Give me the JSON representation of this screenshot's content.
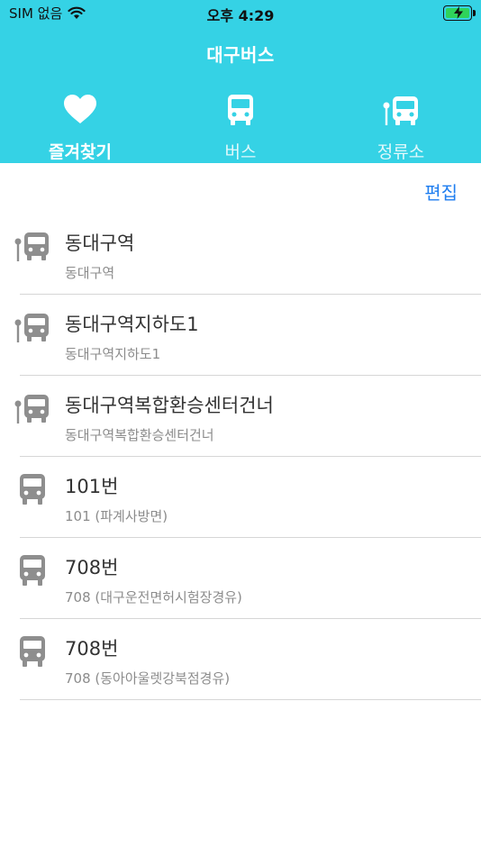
{
  "status_bar": {
    "carrier": "SIM 없음",
    "time": "오후 4:29",
    "battery_icon": "charging-battery-icon"
  },
  "header": {
    "title": "대구버스"
  },
  "tabs": [
    {
      "label": "즐겨찾기",
      "icon": "heart-icon",
      "active": true
    },
    {
      "label": "버스",
      "icon": "bus-icon",
      "active": false
    },
    {
      "label": "정류소",
      "icon": "bus-stop-icon",
      "active": false
    }
  ],
  "toolbar": {
    "edit_label": "편집"
  },
  "favorites": [
    {
      "type": "stop",
      "icon": "bus-stop-icon",
      "title": "동대구역",
      "subtitle": "동대구역"
    },
    {
      "type": "stop",
      "icon": "bus-stop-icon",
      "title": "동대구역지하도1",
      "subtitle": "동대구역지하도1"
    },
    {
      "type": "stop",
      "icon": "bus-stop-icon",
      "title": "동대구역복합환승센터건너",
      "subtitle": "동대구역복합환승센터건너"
    },
    {
      "type": "bus",
      "icon": "bus-icon",
      "title": "101번",
      "subtitle": "101 (파계사방면)"
    },
    {
      "type": "bus",
      "icon": "bus-icon",
      "title": "708번",
      "subtitle": "708 (대구운전면허시험장경유)"
    },
    {
      "type": "bus",
      "icon": "bus-icon",
      "title": "708번",
      "subtitle": "708 (동아아울렛강북점경유)"
    }
  ],
  "colors": {
    "header_bg": "#35d2e5",
    "accent": "#1f7ef0",
    "icon_gray": "#8e8e8e"
  }
}
